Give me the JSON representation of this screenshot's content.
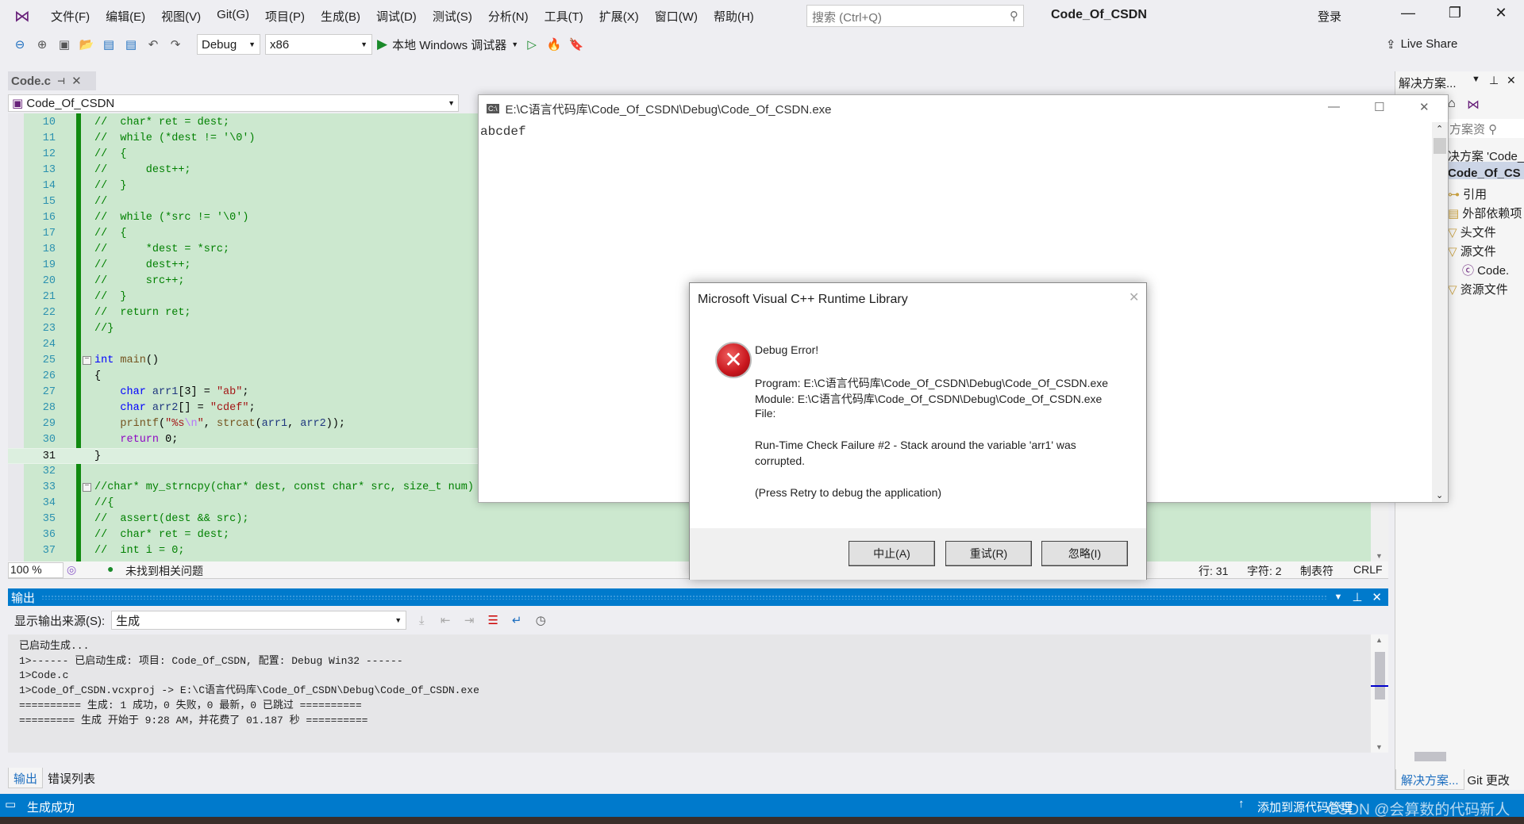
{
  "menubar": {
    "items": [
      "文件(F)",
      "编辑(E)",
      "视图(V)",
      "Git(G)",
      "项目(P)",
      "生成(B)",
      "调试(D)",
      "测试(S)",
      "分析(N)",
      "工具(T)",
      "扩展(X)",
      "窗口(W)",
      "帮助(H)"
    ],
    "search_placeholder": "搜索 (Ctrl+Q)",
    "app_title": "Code_Of_CSDN",
    "login": "登录"
  },
  "toolbar": {
    "config": "Debug",
    "platform": "x86",
    "run_label": "本地 Windows 调试器",
    "live_share": "Live Share"
  },
  "editor": {
    "tab": "Code.c",
    "nav_scope": "Code_Of_CSDN",
    "current_line": 31,
    "lines": [
      {
        "n": "10",
        "s": [
          {
            "c": "comment",
            "t": "//  char* ret = dest;"
          }
        ]
      },
      {
        "n": "11",
        "s": [
          {
            "c": "comment",
            "t": "//  while (*dest != '\\0')"
          }
        ]
      },
      {
        "n": "12",
        "s": [
          {
            "c": "comment",
            "t": "//  {"
          }
        ]
      },
      {
        "n": "13",
        "s": [
          {
            "c": "comment",
            "t": "//      dest++;"
          }
        ]
      },
      {
        "n": "14",
        "s": [
          {
            "c": "comment",
            "t": "//  }"
          }
        ]
      },
      {
        "n": "15",
        "s": [
          {
            "c": "comment",
            "t": "//"
          }
        ]
      },
      {
        "n": "16",
        "s": [
          {
            "c": "comment",
            "t": "//  while (*src != '\\0')"
          }
        ]
      },
      {
        "n": "17",
        "s": [
          {
            "c": "comment",
            "t": "//  {"
          }
        ]
      },
      {
        "n": "18",
        "s": [
          {
            "c": "comment",
            "t": "//      *dest = *src;"
          }
        ]
      },
      {
        "n": "19",
        "s": [
          {
            "c": "comment",
            "t": "//      dest++;"
          }
        ]
      },
      {
        "n": "20",
        "s": [
          {
            "c": "comment",
            "t": "//      src++;"
          }
        ]
      },
      {
        "n": "21",
        "s": [
          {
            "c": "comment",
            "t": "//  }"
          }
        ]
      },
      {
        "n": "22",
        "s": [
          {
            "c": "comment",
            "t": "//  return ret;"
          }
        ]
      },
      {
        "n": "23",
        "s": [
          {
            "c": "comment",
            "t": "//}"
          }
        ]
      },
      {
        "n": "24",
        "s": []
      },
      {
        "n": "25",
        "fold": true,
        "s": [
          {
            "c": "kw",
            "t": "int"
          },
          {
            "c": "plain",
            "t": " "
          },
          {
            "c": "fn",
            "t": "main"
          },
          {
            "c": "plain",
            "t": "()"
          }
        ]
      },
      {
        "n": "26",
        "s": [
          {
            "c": "plain",
            "t": "{"
          }
        ]
      },
      {
        "n": "27",
        "s": [
          {
            "c": "plain",
            "t": "    "
          },
          {
            "c": "kw",
            "t": "char"
          },
          {
            "c": "plain",
            "t": " "
          },
          {
            "c": "var",
            "t": "arr1"
          },
          {
            "c": "plain",
            "t": "[3] = "
          },
          {
            "c": "str",
            "t": "\"ab\""
          },
          {
            "c": "plain",
            "t": ";"
          }
        ]
      },
      {
        "n": "28",
        "s": [
          {
            "c": "plain",
            "t": "    "
          },
          {
            "c": "kw",
            "t": "char"
          },
          {
            "c": "plain",
            "t": " "
          },
          {
            "c": "var",
            "t": "arr2"
          },
          {
            "c": "plain",
            "t": "[] = "
          },
          {
            "c": "str",
            "t": "\"cdef\""
          },
          {
            "c": "plain",
            "t": ";"
          }
        ]
      },
      {
        "n": "29",
        "s": [
          {
            "c": "plain",
            "t": "    "
          },
          {
            "c": "fn",
            "t": "printf"
          },
          {
            "c": "plain",
            "t": "("
          },
          {
            "c": "str",
            "t": "\"%s"
          },
          {
            "c": "esc",
            "t": "\\n"
          },
          {
            "c": "str",
            "t": "\""
          },
          {
            "c": "plain",
            "t": ", "
          },
          {
            "c": "fn",
            "t": "strcat"
          },
          {
            "c": "plain",
            "t": "("
          },
          {
            "c": "var",
            "t": "arr1"
          },
          {
            "c": "plain",
            "t": ", "
          },
          {
            "c": "var",
            "t": "arr2"
          },
          {
            "c": "plain",
            "t": "));"
          }
        ]
      },
      {
        "n": "30",
        "s": [
          {
            "c": "plain",
            "t": "    "
          },
          {
            "c": "ctl",
            "t": "return"
          },
          {
            "c": "plain",
            "t": " 0;"
          }
        ]
      },
      {
        "n": "31",
        "s": [
          {
            "c": "plain",
            "t": "}"
          }
        ]
      },
      {
        "n": "32",
        "s": []
      },
      {
        "n": "33",
        "fold": true,
        "s": [
          {
            "c": "comment",
            "t": "//char* my_strncpy(char* dest, const char* src, size_t num)"
          }
        ]
      },
      {
        "n": "34",
        "s": [
          {
            "c": "comment",
            "t": "//{"
          }
        ]
      },
      {
        "n": "35",
        "s": [
          {
            "c": "comment",
            "t": "//  assert(dest && src);"
          }
        ]
      },
      {
        "n": "36",
        "s": [
          {
            "c": "comment",
            "t": "//  char* ret = dest;"
          }
        ]
      },
      {
        "n": "37",
        "s": [
          {
            "c": "comment",
            "t": "//  int i = 0;"
          }
        ]
      }
    ],
    "status": {
      "zoom": "100 %",
      "issues": "未找到相关问题",
      "line": "行: 31",
      "char": "字符: 2",
      "tabs": "制表符",
      "eol": "CRLF"
    }
  },
  "output": {
    "title": "输出",
    "source_label": "显示输出来源(S):",
    "source_value": "生成",
    "lines": [
      "已启动生成...",
      "1>------ 已启动生成: 项目: Code_Of_CSDN, 配置: Debug Win32 ------",
      "1>Code.c",
      "1>Code_Of_CSDN.vcxproj -> E:\\C语言代码库\\Code_Of_CSDN\\Debug\\Code_Of_CSDN.exe",
      "========== 生成: 1 成功，0 失败，0 最新，0 已跳过 ==========",
      "========= 生成 开始于 9:28 AM，并花费了 01.187 秒 =========="
    ],
    "tabs": [
      "输出",
      "错误列表"
    ]
  },
  "solution": {
    "title": "解决方案...",
    "search": "方案资",
    "items": [
      "决方案 'Code_",
      "Code_Of_CS",
      "引用",
      "外部依赖项",
      "头文件",
      "源文件",
      "Code.",
      "资源文件"
    ],
    "tabs": [
      "解决方案...",
      "Git 更改"
    ]
  },
  "statusbar": {
    "left": "生成成功",
    "source_control": "添加到源代码管理",
    "watermark": "CSDN @会算数的代码新人"
  },
  "console": {
    "title": "E:\\C语言代码库\\Code_Of_CSDN\\Debug\\Code_Of_CSDN.exe",
    "output": "abcdef"
  },
  "dialog": {
    "title": "Microsoft Visual C++ Runtime Library",
    "heading": "Debug Error!",
    "program": "Program: E:\\C语言代码库\\Code_Of_CSDN\\Debug\\Code_Of_CSDN.exe",
    "module": "Module: E:\\C语言代码库\\Code_Of_CSDN\\Debug\\Code_Of_CSDN.exe",
    "file": "File:",
    "failure_1": "Run-Time Check Failure #2 - Stack around the variable 'arr1' was",
    "failure_2": "corrupted.",
    "hint": "(Press Retry to debug the application)",
    "buttons": {
      "abort": "中止(A)",
      "retry": "重试(R)",
      "ignore": "忽略(I)"
    }
  },
  "colors": {
    "accent": "#007acc",
    "editor_bg": "#cce8cf",
    "error_red": "#c8161d"
  }
}
